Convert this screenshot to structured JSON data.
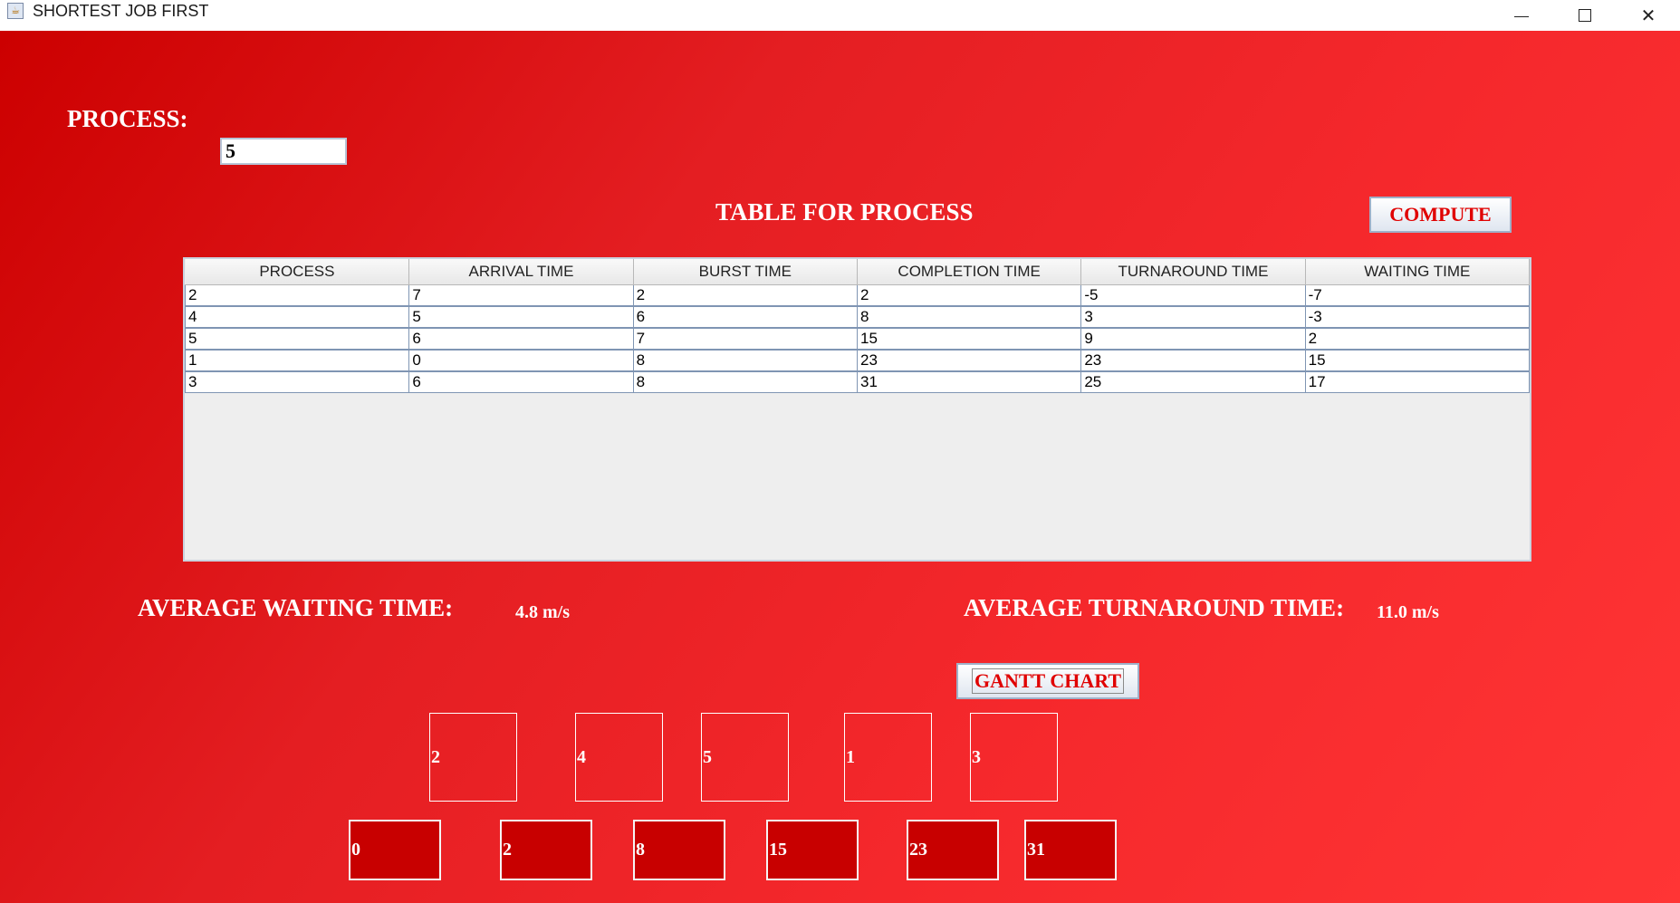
{
  "window": {
    "title": "SHORTEST JOB FIRST",
    "app_icon": "java-coffee-cup-icon",
    "controls": [
      "minimize-icon",
      "maximize-icon",
      "close-icon"
    ]
  },
  "form": {
    "process_label": "PROCESS:",
    "process_value": "5",
    "table_title": "TABLE FOR PROCESS",
    "compute_label": "COMPUTE",
    "gantt_label": "GANTT CHART"
  },
  "table": {
    "headers": [
      "PROCESS",
      "ARRIVAL TIME",
      "BURST TIME",
      "COMPLETION TIME",
      "TURNAROUND TIME",
      "WAITING TIME"
    ],
    "rows": [
      [
        "2",
        "7",
        "2",
        "2",
        "-5",
        "-7"
      ],
      [
        "4",
        "5",
        "6",
        "8",
        "3",
        "-3"
      ],
      [
        "5",
        "6",
        "7",
        "15",
        "9",
        "2"
      ],
      [
        "1",
        "0",
        "8",
        "23",
        "23",
        "15"
      ],
      [
        "3",
        "6",
        "8",
        "31",
        "25",
        "17"
      ]
    ]
  },
  "averages": {
    "waiting_label": "AVERAGE WAITING TIME:",
    "waiting_value": "4.8 m/s",
    "turnaround_label": "AVERAGE TURNAROUND TIME:",
    "turnaround_value": "11.0 m/s"
  },
  "gantt": {
    "processes": [
      "2",
      "4",
      "5",
      "1",
      "3"
    ],
    "times": [
      "0",
      "2",
      "8",
      "15",
      "23",
      "31"
    ]
  },
  "colors": {
    "background_start": "#cc0000",
    "background_end": "#ff3535",
    "button_text": "#e00000",
    "time_box": "#c80000"
  }
}
